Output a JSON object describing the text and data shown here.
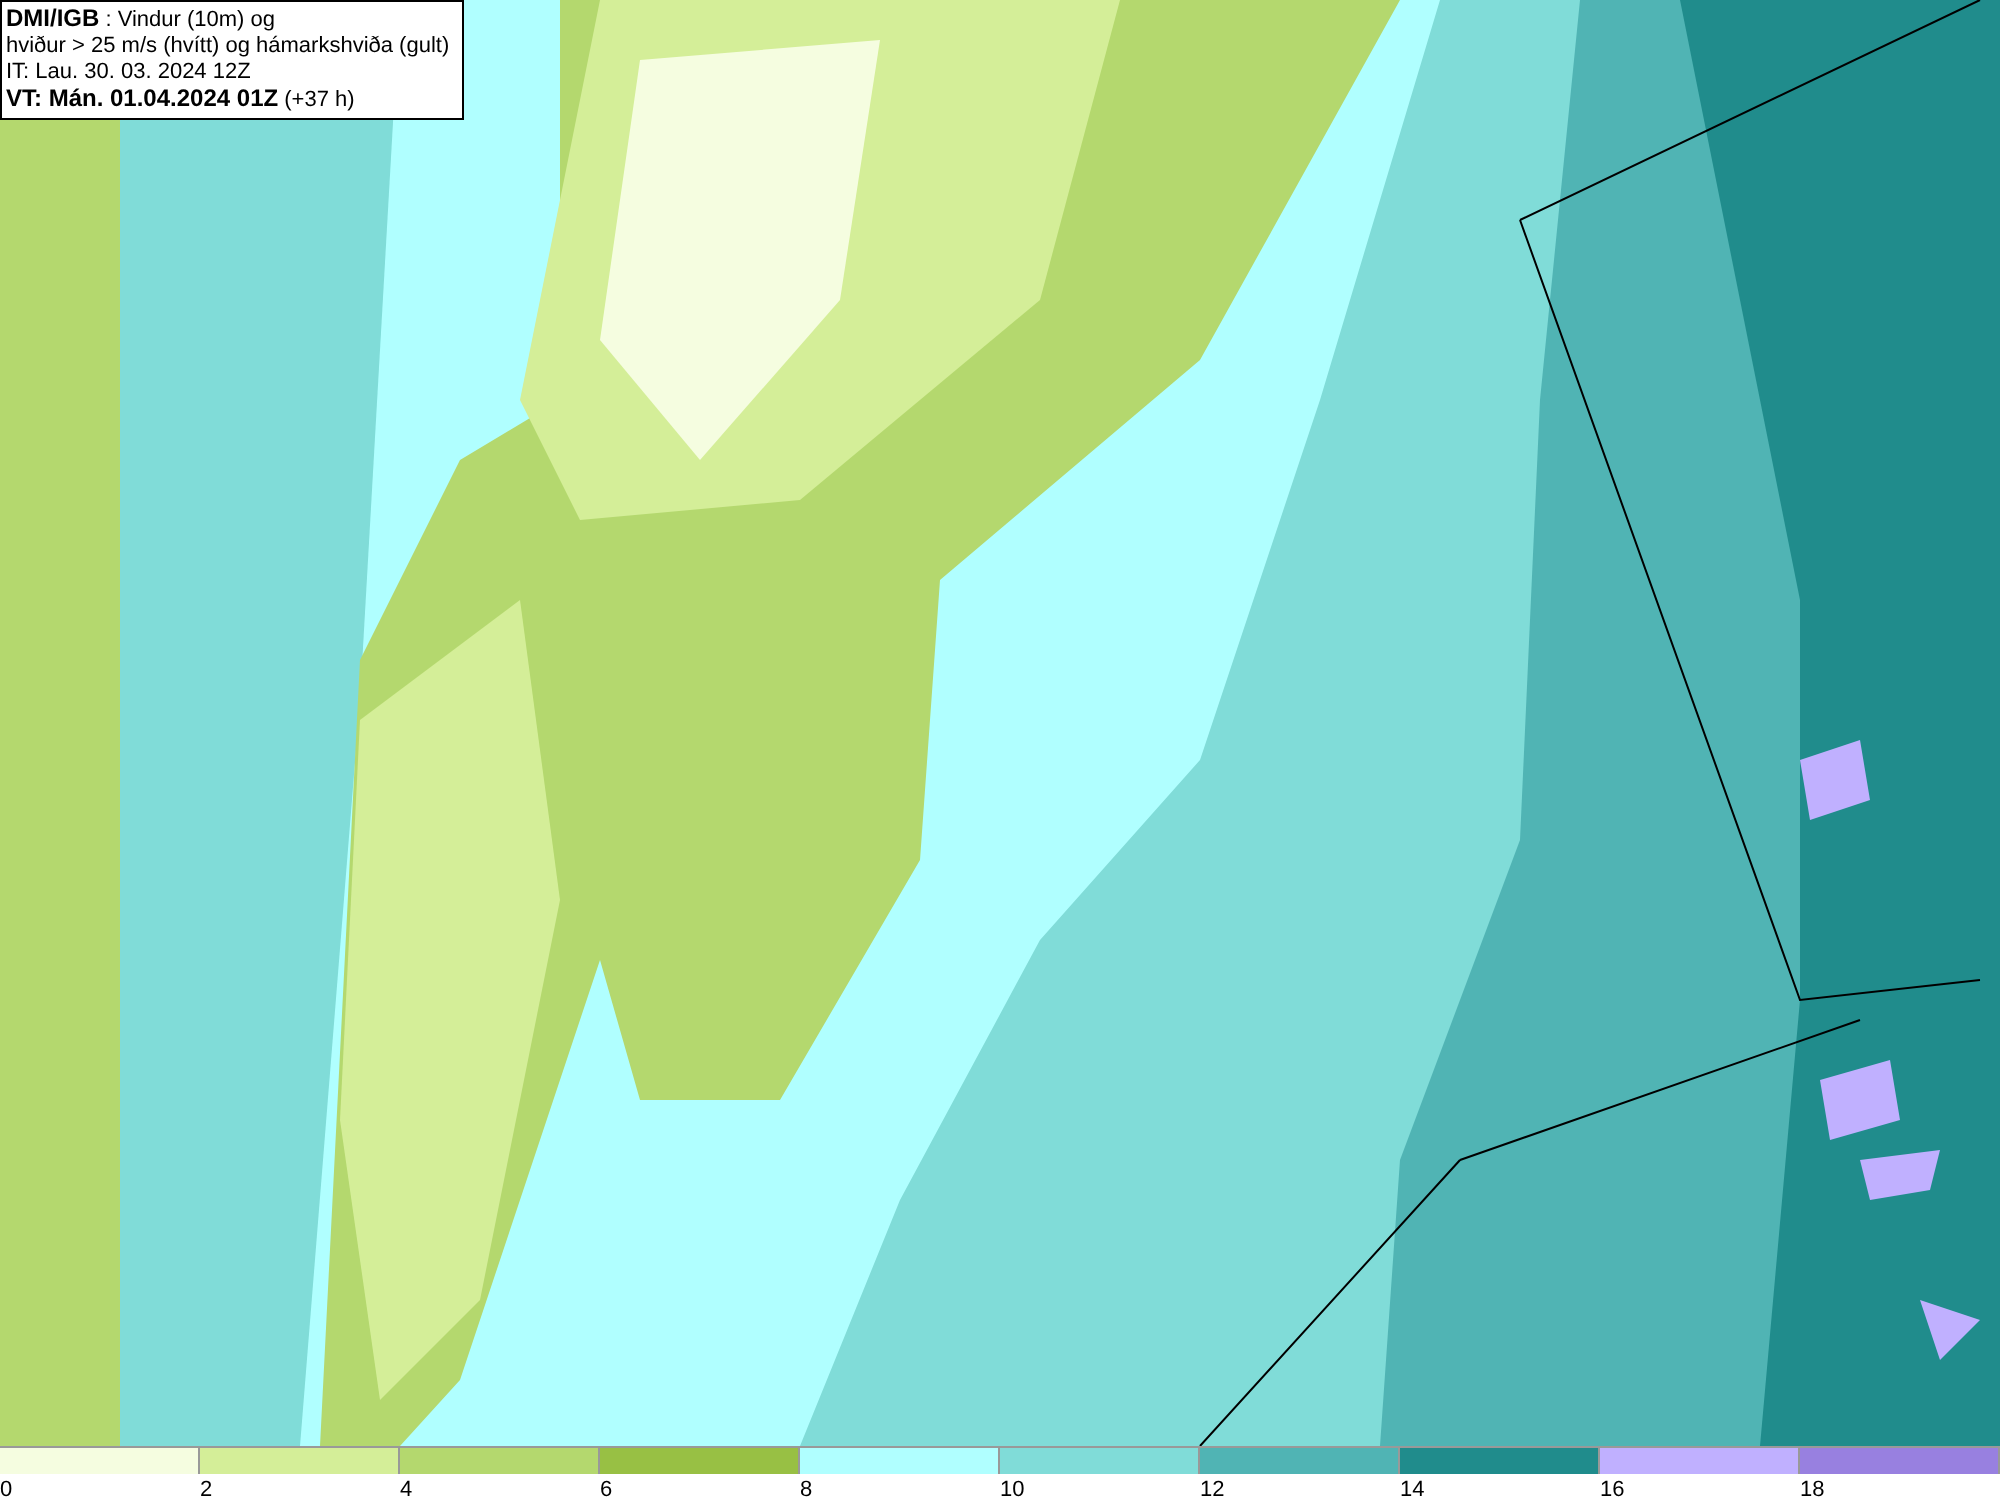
{
  "title_box": {
    "lines": [
      {
        "bold": "DMI/IGB",
        "text": " : Vindur (10m) og"
      },
      {
        "text": "hviður > 25 m/s (hvítt) og hámarkshviða (gult)"
      },
      {
        "text": "IT: Lau. 30. 03. 2024 12Z"
      },
      {
        "bold": "VT: Mán. 01.04.2024 01Z",
        "text": " (+37 h)"
      }
    ]
  },
  "legend": [
    {
      "label": "0",
      "color": "#f5fde0"
    },
    {
      "label": "2",
      "color": "#d4ee98"
    },
    {
      "label": "4",
      "color": "#b4d86e"
    },
    {
      "label": "6",
      "color": "#98c044"
    },
    {
      "label": "8",
      "color": "#b0ffff"
    },
    {
      "label": "10",
      "color": "#80dcd8"
    },
    {
      "label": "12",
      "color": "#50b4b4"
    },
    {
      "label": "14",
      "color": "#208c8c"
    },
    {
      "label": "16",
      "color": "#c0b0ff"
    },
    {
      "label": "18",
      "color": "#9880e0"
    }
  ]
}
